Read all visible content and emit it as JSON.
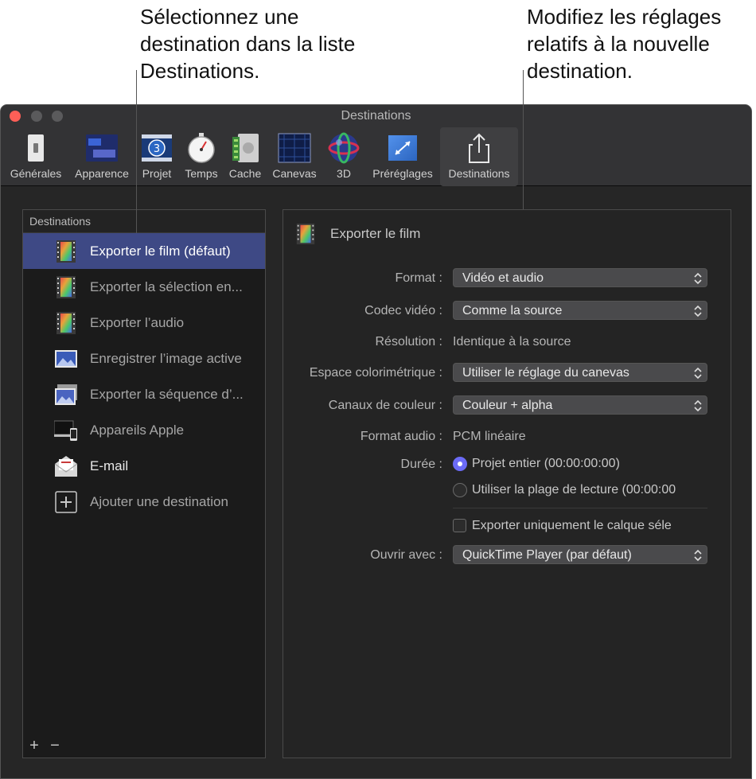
{
  "callouts": {
    "left": "Sélectionnez une destination dans la liste Destinations.",
    "right": "Modifiez les réglages relatifs à la nouvelle destination."
  },
  "window": {
    "title": "Destinations"
  },
  "toolbar": {
    "items": [
      {
        "label": "Générales",
        "icon": "switch-icon"
      },
      {
        "label": "Apparence",
        "icon": "appearance-icon"
      },
      {
        "label": "Projet",
        "icon": "project-icon",
        "badge": "3"
      },
      {
        "label": "Temps",
        "icon": "stopwatch-icon"
      },
      {
        "label": "Cache",
        "icon": "cache-icon"
      },
      {
        "label": "Canevas",
        "icon": "canvas-icon"
      },
      {
        "label": "3D",
        "icon": "3d-sphere-icon"
      },
      {
        "label": "Préréglages",
        "icon": "presets-icon"
      },
      {
        "label": "Destinations",
        "icon": "share-icon",
        "selected": true
      }
    ]
  },
  "sidebar": {
    "header": "Destinations",
    "items": [
      {
        "label": "Exporter le film (défaut)",
        "icon": "film-icon",
        "selected": true
      },
      {
        "label": "Exporter la sélection en...",
        "icon": "film-icon"
      },
      {
        "label": "Exporter l’audio",
        "icon": "film-icon"
      },
      {
        "label": "Enregistrer l’image active",
        "icon": "image-icon"
      },
      {
        "label": "Exporter la séquence d’...",
        "icon": "image-sequence-icon"
      },
      {
        "label": "Appareils Apple",
        "icon": "apple-devices-icon"
      },
      {
        "label": "E-mail",
        "icon": "mail-icon"
      },
      {
        "label": "Ajouter une destination",
        "icon": "add-icon"
      }
    ],
    "footer": {
      "add": "+",
      "remove": "−"
    }
  },
  "panel": {
    "title": "Exporter le film",
    "format": {
      "label": "Format :",
      "value": "Vidéo et audio"
    },
    "codec": {
      "label": "Codec vidéo :",
      "value": "Comme la source"
    },
    "resolution": {
      "label": "Résolution :",
      "value": "Identique à la source"
    },
    "colorspace": {
      "label": "Espace colorimétrique :",
      "value": "Utiliser le réglage du canevas"
    },
    "channels": {
      "label": "Canaux de couleur :",
      "value": "Couleur + alpha"
    },
    "audio_format": {
      "label": "Format audio :",
      "value": "PCM linéaire"
    },
    "duration": {
      "label": "Durée :",
      "options": [
        "Projet entier (00:00:00:00)",
        "Utiliser la plage de lecture (00:00:00"
      ],
      "selected": 0
    },
    "export_layer": {
      "label": "Exporter uniquement le calque séle",
      "checked": false
    },
    "open_with": {
      "label": "Ouvrir avec :",
      "value": "QuickTime Player (par défaut)"
    }
  },
  "colors": {
    "selection": "#3e4985",
    "radio_accent": "#6b6bf7",
    "window_bg": "#262626"
  }
}
